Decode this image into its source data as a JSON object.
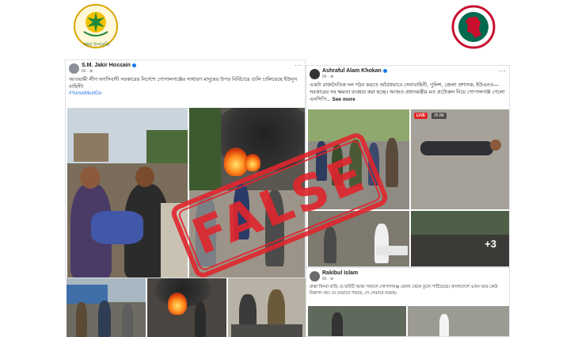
{
  "colors": {
    "stamp_red": "#e0262d",
    "facebook_blue": "#1877f2",
    "hashtag_blue": "#216fdb",
    "live_red": "#e02424"
  },
  "logos": {
    "left": {
      "icon": "government-emblem-icon",
      "caption": "সময় উপরেতি"
    },
    "right": {
      "icon": "bangladesh-seal-icon"
    }
  },
  "posts": [
    {
      "author": "S.M. Jakir Hossain",
      "meta": "6h · ⊕",
      "text": "আওয়ামী লীগ ফ্যাসিবাদী সরকারের নির্দেশে গোপালগঞ্জের সাধারণ মানুষের উপর নির্বিচারে গুলি চালিয়েছে ইউনূস বাহিনী!",
      "hashtag": "#YunusMustGo"
    },
    {
      "author": "Ashraful Alam Khokan",
      "meta": "6h · ⊕",
      "text": "একটা রাজনৈতিক দল গঠন করতে অবৈধভাবে সেনাবাহিনী, পুলিশ, জেলা প্রশাসক, ইউএনও—সরকারের সব ক্ষমতা ব্যবহার করা হচ্ছে। আজও প্রধানমন্ত্রীর মত প্রটোকল নিয়ে গোপালগঞ্জ গেলো এনসিপি...",
      "see_more": "See more",
      "live_label": "LIVE",
      "views": "25.8K",
      "extra_photos": "+3"
    },
    {
      "author": "Rakibul Islam",
      "meta": "6h · ⊕",
      "text": "রাস্তা কিংবা বাড়ি যে ছবিটি আজ সকালে গোপালগঞ্জ জেলা থেকে তুলে পাঠিয়েছে। বাংলাদেশে এখন আর কেউ নিরাপদ নয়। যে যেভাবে পারছে, সে সেভাবে মারছে।"
    }
  ],
  "stamp": {
    "text": "FALSE"
  }
}
